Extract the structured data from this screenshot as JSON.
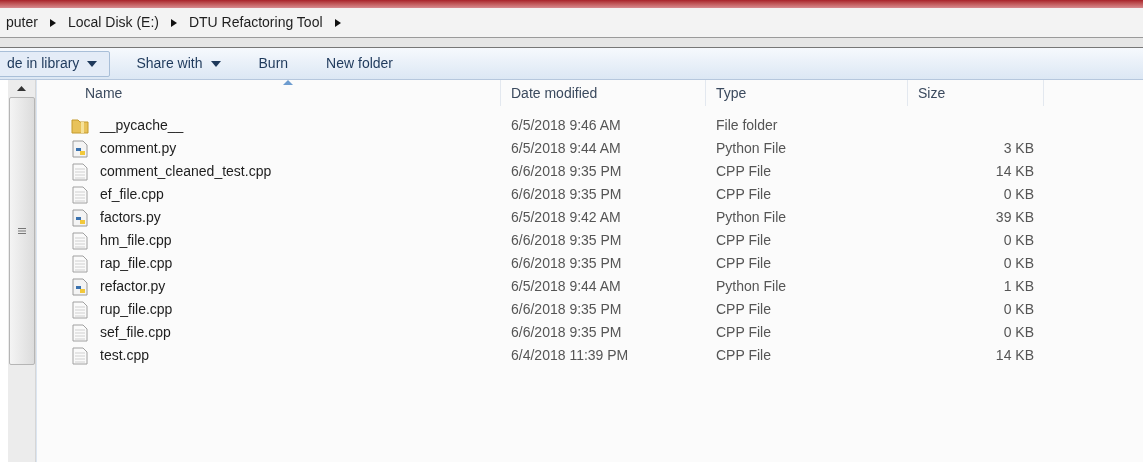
{
  "breadcrumb": [
    "puter",
    "Local Disk (E:)",
    "DTU Refactoring Tool"
  ],
  "toolbar": [
    {
      "label": "de in library",
      "dropdown": true,
      "boxed": true
    },
    {
      "label": "Share with",
      "dropdown": true,
      "boxed": false
    },
    {
      "label": "Burn",
      "dropdown": false,
      "boxed": false
    },
    {
      "label": "New folder",
      "dropdown": false,
      "boxed": false
    }
  ],
  "columns": [
    "Name",
    "Date modified",
    "Type",
    "Size"
  ],
  "rows": [
    {
      "kind": "folder",
      "name": "__pycache__",
      "date": "6/5/2018 9:46 AM",
      "type": "File folder"
    },
    {
      "kind": "python",
      "name": "comment.py",
      "date": "6/5/2018 9:44 AM",
      "type": "Python File",
      "size": "3 KB"
    },
    {
      "kind": "file",
      "name": "comment_cleaned_test.cpp",
      "date": "6/6/2018 9:35 PM",
      "type": "CPP File",
      "size": "14 KB"
    },
    {
      "kind": "file",
      "name": "ef_file.cpp",
      "date": "6/6/2018 9:35 PM",
      "type": "CPP File",
      "size": "0 KB"
    },
    {
      "kind": "python",
      "name": "factors.py",
      "date": "6/5/2018 9:42 AM",
      "type": "Python File",
      "size": "39 KB"
    },
    {
      "kind": "file",
      "name": "hm_file.cpp",
      "date": "6/6/2018 9:35 PM",
      "type": "CPP File",
      "size": "0 KB"
    },
    {
      "kind": "file",
      "name": "rap_file.cpp",
      "date": "6/6/2018 9:35 PM",
      "type": "CPP File",
      "size": "0 KB"
    },
    {
      "kind": "python",
      "name": "refactor.py",
      "date": "6/5/2018 9:44 AM",
      "type": "Python File",
      "size": "1 KB"
    },
    {
      "kind": "file",
      "name": "rup_file.cpp",
      "date": "6/6/2018 9:35 PM",
      "type": "CPP File",
      "size": "0 KB"
    },
    {
      "kind": "file",
      "name": "sef_file.cpp",
      "date": "6/6/2018 9:35 PM",
      "type": "CPP File",
      "size": "0 KB"
    },
    {
      "kind": "file",
      "name": "test.cpp",
      "date": "6/4/2018 11:39 PM",
      "type": "CPP File",
      "size": "14 KB"
    }
  ]
}
